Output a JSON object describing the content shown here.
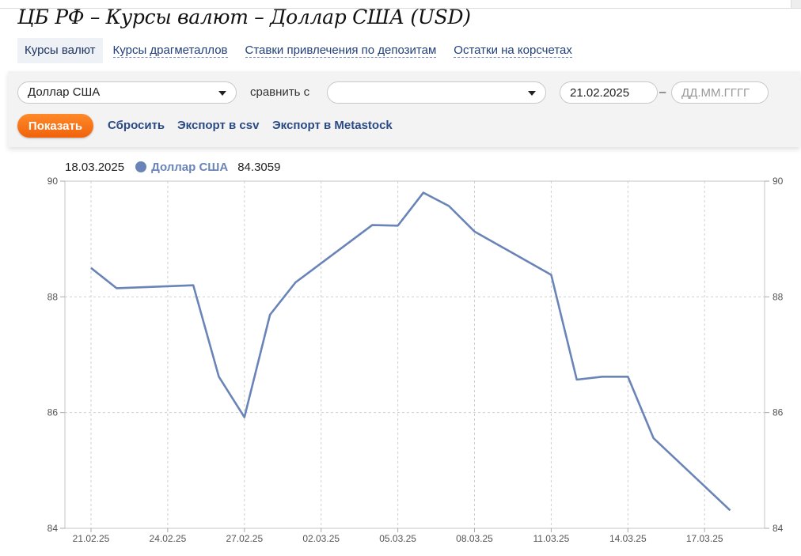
{
  "page": {
    "title": "ЦБ РФ – Курсы валют – Доллар США (USD)"
  },
  "tabs": [
    {
      "label": "Курсы валют",
      "active": true
    },
    {
      "label": "Курсы драгметаллов",
      "active": false
    },
    {
      "label": "Ставки привлечения по депозитам",
      "active": false
    },
    {
      "label": "Остатки на корсчетах",
      "active": false
    }
  ],
  "controls": {
    "currency_select": "Доллар США",
    "compare_label": "сравнить с",
    "compare_select": "",
    "date_from": "21.02.2025",
    "date_to_value": "",
    "date_to_placeholder": "ДД.ММ.ГГГГ",
    "dash": "–",
    "show_button": "Показать",
    "reset_link": "Сбросить",
    "export_csv_link": "Экспорт в csv",
    "export_metastock_link": "Экспорт в Metastock"
  },
  "legend": {
    "date": "18.03.2025",
    "series": "Доллар США",
    "value": "84.3059"
  },
  "colors": {
    "line": "#6a84b8",
    "accent_orange": "#f5731a",
    "link": "#2a4a86"
  },
  "chart_data": {
    "type": "line",
    "x": [
      "21.02.25",
      "22.02.25",
      "25.02.25",
      "26.02.25",
      "27.02.25",
      "28.02.25",
      "01.03.25",
      "04.03.25",
      "05.03.25",
      "06.03.25",
      "07.03.25",
      "08.03.25",
      "11.03.25",
      "12.03.25",
      "13.03.25",
      "14.03.25",
      "15.03.25",
      "18.03.25"
    ],
    "series": [
      {
        "name": "Доллар США",
        "values": [
          88.5,
          88.15,
          88.2,
          86.62,
          85.92,
          87.69,
          88.25,
          89.24,
          89.23,
          89.8,
          89.57,
          89.13,
          88.38,
          86.57,
          86.62,
          86.62,
          85.56,
          84.31
        ]
      }
    ],
    "x_ticks": [
      "21.02.25",
      "24.02.25",
      "27.02.25",
      "02.03.25",
      "05.03.25",
      "08.03.25",
      "11.03.25",
      "14.03.25",
      "17.03.25"
    ],
    "y_ticks": [
      84,
      86,
      88,
      90
    ],
    "ylim": [
      84,
      90
    ],
    "grid": true,
    "legend_placement": "top-left"
  }
}
